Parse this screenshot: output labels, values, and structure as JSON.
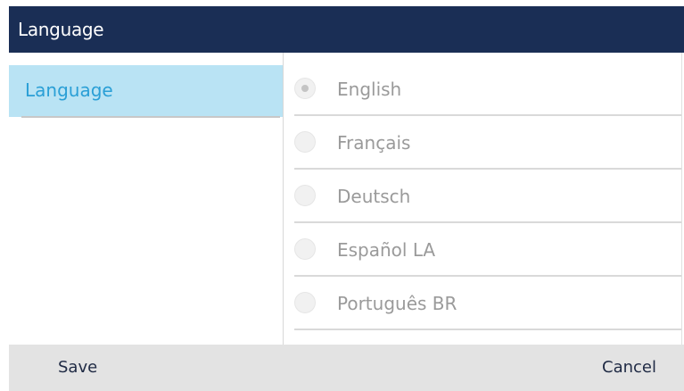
{
  "header": {
    "title": "Language"
  },
  "sidebar": {
    "items": [
      {
        "label": "Language",
        "selected": true
      }
    ]
  },
  "language_options": {
    "selected": "English",
    "items": [
      {
        "label": "English",
        "checked": true
      },
      {
        "label": "Français",
        "checked": false
      },
      {
        "label": "Deutsch",
        "checked": false
      },
      {
        "label": "Español LA",
        "checked": false
      },
      {
        "label": "Português BR",
        "checked": false
      }
    ]
  },
  "softkeys": {
    "save_label": "Save",
    "cancel_label": "Cancel"
  },
  "colors": {
    "header_background": "#1a2e55",
    "selected_item_background": "#b9e3f4",
    "selected_item_text": "#2a9fd6",
    "softkey_bar_background": "#e3e3e3"
  }
}
